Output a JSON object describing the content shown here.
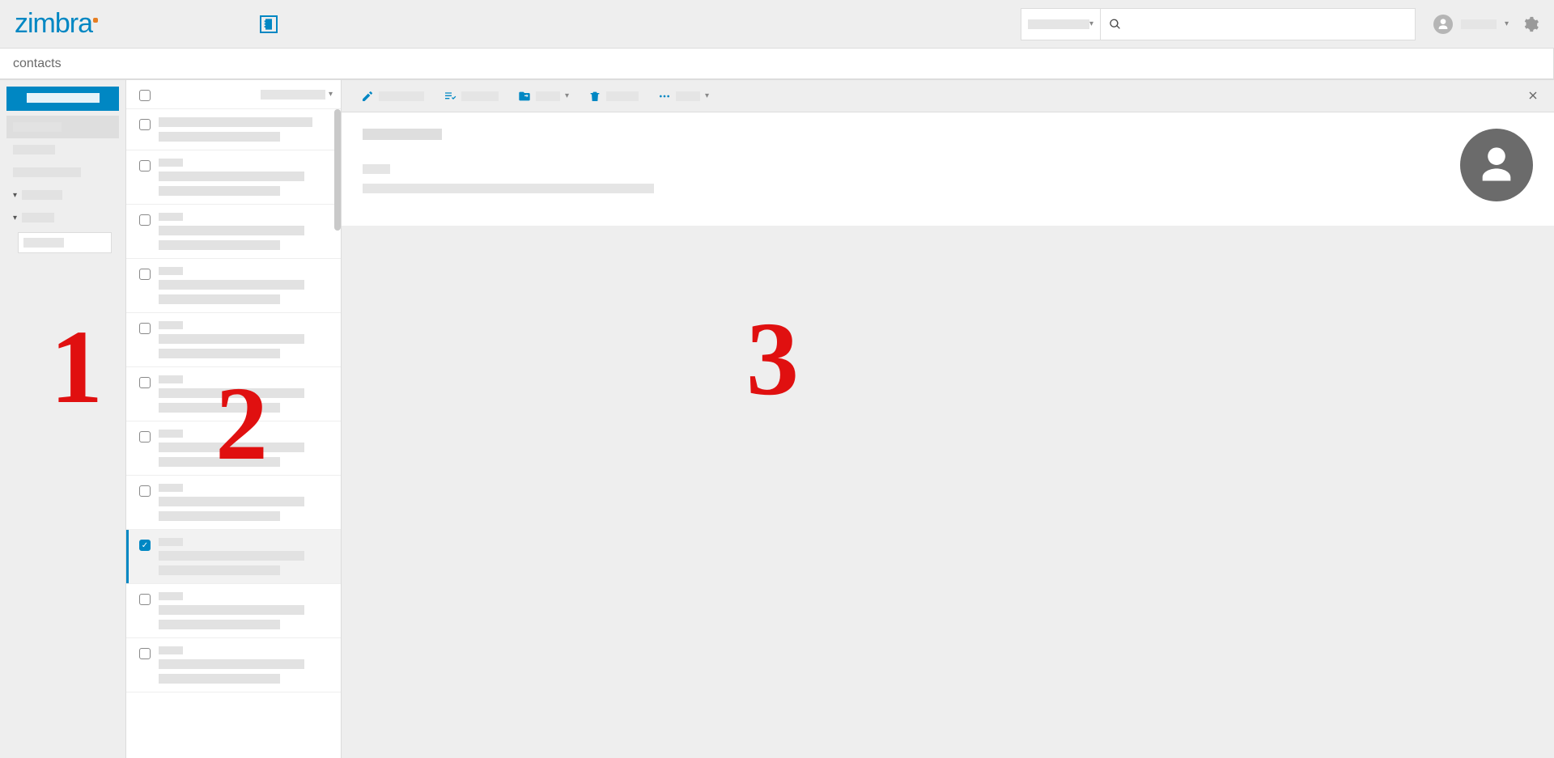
{
  "header": {
    "logo_text": "zimbra",
    "search_placeholder": "",
    "user_name": "",
    "nav_tab_contacts": "contacts"
  },
  "breadcrumb": "contacts",
  "sidebar": {
    "new_button_label": "",
    "items": [
      {
        "label": "",
        "active": true,
        "expandable": false
      },
      {
        "label": "",
        "active": false,
        "expandable": false
      },
      {
        "label": "",
        "active": false,
        "expandable": false
      },
      {
        "label": "",
        "active": false,
        "expandable": true
      },
      {
        "label": "",
        "active": false,
        "expandable": true
      }
    ],
    "add_input_value": ""
  },
  "list": {
    "sort_label": "",
    "items": [
      {
        "name": "",
        "email": "",
        "selected": false
      },
      {
        "name": "",
        "email": "",
        "selected": false
      },
      {
        "name": "",
        "email": "",
        "selected": false
      },
      {
        "name": "",
        "email": "",
        "selected": false
      },
      {
        "name": "",
        "email": "",
        "selected": false
      },
      {
        "name": "",
        "email": "",
        "selected": false
      },
      {
        "name": "",
        "email": "",
        "selected": false
      },
      {
        "name": "",
        "email": "",
        "selected": false
      },
      {
        "name": "",
        "email": "",
        "selected": true
      },
      {
        "name": "",
        "email": "",
        "selected": false
      },
      {
        "name": "",
        "email": "",
        "selected": false
      }
    ]
  },
  "toolbar": {
    "edit_label": "",
    "assign_label": "",
    "move_label": "",
    "delete_label": "",
    "more_label": ""
  },
  "detail": {
    "title": "",
    "subtitle": "",
    "body": ""
  },
  "annotations": {
    "pane1": "1",
    "pane2": "2",
    "pane3": "3"
  }
}
